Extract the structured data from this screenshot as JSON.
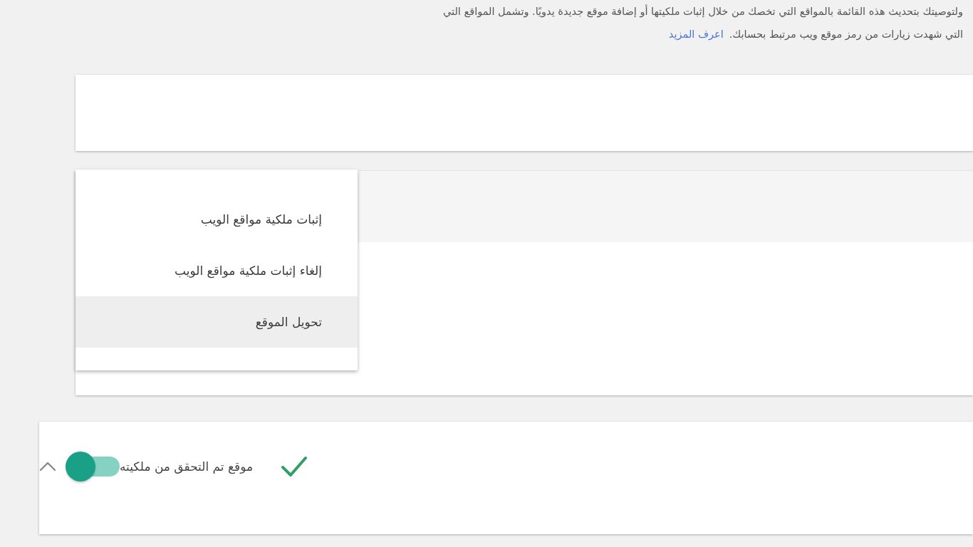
{
  "intro": {
    "lines": [
      "ولتوصيتك بتحديث هذه القائمة بالمواقع التي تخصك من خلال إثبات ملكيتها أو إضافة موقع جديدة يدويًا. وتشمل المواقع التي",
      "التي شهدت زيارات من رمز موقع ويب مرتبط بحسابك."
    ],
    "link": "اعرف المزيد"
  },
  "menu": {
    "items": [
      {
        "label": "إثبات ملكية مواقع الويب",
        "selected": false
      },
      {
        "label": "إلغاء إثبات ملكية مواقع الويب",
        "selected": false
      },
      {
        "label": "تحويل الموقع",
        "selected": true
      }
    ]
  },
  "verified_site": {
    "verified": true,
    "label": "موقع تم التحقق من ملكيته",
    "toggle": {
      "on": true
    },
    "expanded": true
  }
}
